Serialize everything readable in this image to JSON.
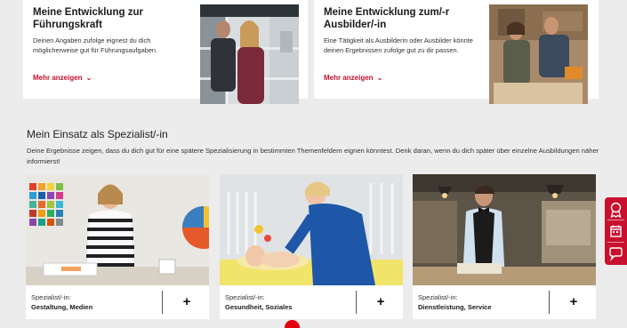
{
  "top_cards": [
    {
      "title": "Meine Entwicklung zur Führungskraft",
      "text": "Deinen Angaben zufolge eignest du dich möglicherweise gut für Führungsaufgaben.",
      "more": "Mehr anzeigen"
    },
    {
      "title": "Meine Entwicklung zum/-r Ausbilder/-in",
      "text": "Eine Tätigkeit als Ausbilderin oder Ausbilder könnte deinen Ergebnissen zufolge gut zu dir passen.",
      "more": "Mehr anzeigen"
    }
  ],
  "section": {
    "title": "Mein Einsatz als Spezialist/-in",
    "description": "Deine Ergebnisse zeigen, dass du dich gut für eine spätere Spezialisierung in bestimmten Themenfeldern eignen könntest. Denk daran, wenn du dich später über einzelne Ausbildungen näher informierst!"
  },
  "specialist_cards": [
    {
      "kicker": "Spezialist/-in:",
      "name": "Gestaltung, Medien",
      "action": "+"
    },
    {
      "kicker": "Spezialist/-in:",
      "name": "Gesundheit, Soziales",
      "action": "+"
    },
    {
      "kicker": "Spezialist/-in:",
      "name": "Dienstleistung, Service",
      "action": "+"
    }
  ],
  "sidebar": {
    "icons": [
      "award-icon",
      "calendar-icon",
      "chat-icon"
    ]
  },
  "colors": {
    "accent": "#c8102e",
    "background": "#ececec",
    "card": "#ffffff"
  }
}
